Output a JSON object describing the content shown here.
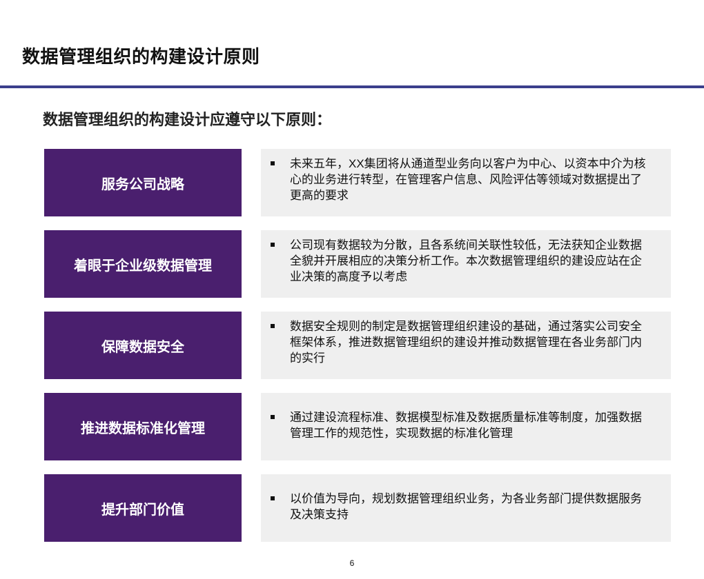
{
  "slide": {
    "title": "数据管理组织的构建设计原则",
    "subtitle": "数据管理组织的构建设计应遵守以下原则：",
    "page_number": "6"
  },
  "principles": [
    {
      "label": "服务公司战略",
      "description": "未来五年，XX集团将从通道型业务向以客户为中心、以资本中介为核心的业务进行转型，在管理客户信息、风险评估等领域对数据提出了更高的要求"
    },
    {
      "label": "着眼于企业级数据管理",
      "description": "公司现有数据较为分散，且各系统间关联性较低，无法获知企业数据全貌并开展相应的决策分析工作。本次数据管理组织的建设应站在企业决策的高度予以考虑"
    },
    {
      "label": "保障数据安全",
      "description": "数据安全规则的制定是数据管理组织建设的基础，通过落实公司安全框架体系，推进数据管理组织的建设并推动数据管理在各业务部门内的实行"
    },
    {
      "label": "推进数据标准化管理",
      "description": "通过建设流程标准、数据模型标准及数据质量标准等制度，加强数据管理工作的规范性，实现数据的标准化管理"
    },
    {
      "label": "提升部门价值",
      "description": "以价值为导向，规划数据管理组织业务，为各业务部门提供数据服务及决策支持"
    }
  ],
  "colors": {
    "label_bg": "#4a1f6e",
    "desc_bg": "#efefef",
    "rule": "#3b3f8c"
  }
}
